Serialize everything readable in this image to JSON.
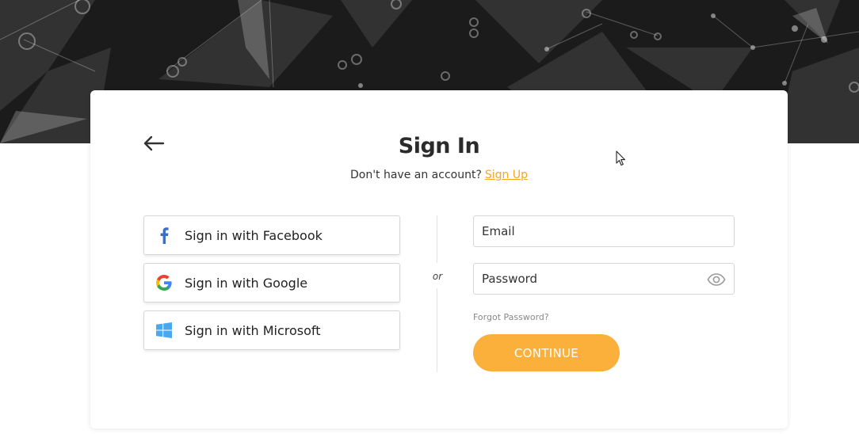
{
  "header": {
    "title": "Sign In",
    "subtitle_text": "Don't have an account?",
    "signup_link": "Sign Up"
  },
  "social_buttons": [
    {
      "label": "Sign in with Facebook",
      "icon": "facebook-icon"
    },
    {
      "label": "Sign in with Google",
      "icon": "google-icon"
    },
    {
      "label": "Sign in with Microsoft",
      "icon": "microsoft-icon"
    }
  ],
  "divider_text": "or",
  "form": {
    "email_placeholder": "Email",
    "email_value": "",
    "password_placeholder": "Password",
    "password_value": "",
    "forgot_label": "Forgot Password?",
    "continue_label": "CONTINUE"
  },
  "colors": {
    "accent": "#fbb03b",
    "link": "#f5a623",
    "hero_background": "#1c1c1c"
  },
  "icons": {
    "back": "arrow-left-icon",
    "password_toggle": "eye-icon"
  }
}
